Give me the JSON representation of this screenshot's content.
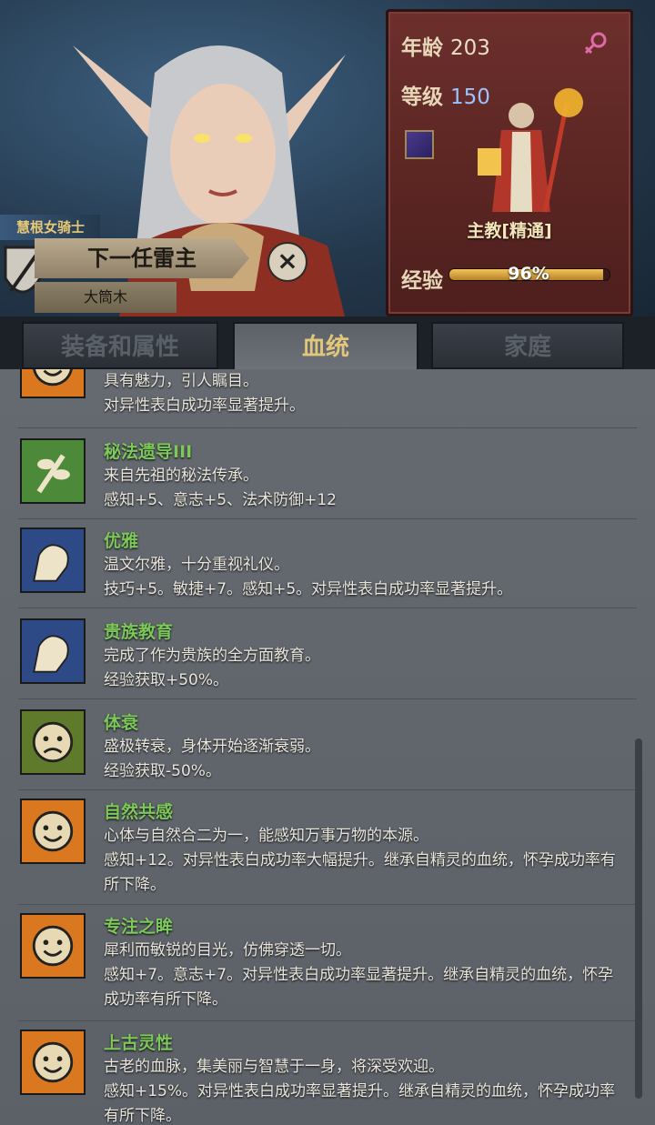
{
  "character": {
    "title": "慧根女骑士",
    "name": "下一任雷主",
    "family": "大筒木"
  },
  "stats": {
    "age_label": "年龄",
    "age_value": "203",
    "level_label": "等级",
    "level_value": "150",
    "class_label": "主教[精通]",
    "exp_label": "经验",
    "exp_value": "96%",
    "exp_fraction": 0.96
  },
  "tabs": [
    {
      "label": "装备和属性",
      "active": false
    },
    {
      "label": "血统",
      "active": true
    },
    {
      "label": "家庭",
      "active": false
    }
  ],
  "traits": [
    {
      "name": "",
      "icon": "happy-face-icon",
      "desc": "具有魅力，引人瞩目。\n对异性表白成功率显著提升。"
    },
    {
      "name": "秘法遗导III",
      "icon": "leaf-branch-icon",
      "desc": "来自先祖的秘法传承。\n感知+5、意志+5、法术防御+12"
    },
    {
      "name": "优雅",
      "icon": "flexed-arm-icon",
      "desc": "温文尔雅，十分重视礼仪。\n技巧+5。敏捷+7。感知+5。对异性表白成功率显著提升。"
    },
    {
      "name": "贵族教育",
      "icon": "flexed-arm-icon",
      "desc": "完成了作为贵族的全方面教育。\n经验获取+50%。"
    },
    {
      "name": "体衰",
      "icon": "sad-face-icon",
      "desc": "盛极转衰，身体开始逐渐衰弱。\n经验获取-50%。"
    },
    {
      "name": "自然共感",
      "icon": "happy-face-icon",
      "desc": "心体与自然合二为一，能感知万事万物的本源。\n感知+12。对异性表白成功率大幅提升。继承自精灵的血统，怀孕成功率有所下降。"
    },
    {
      "name": "专注之眸",
      "icon": "happy-face-icon",
      "desc": "犀利而敏锐的目光，仿佛穿透一切。\n感知+7。意志+7。对异性表白成功率显著提升。继承自精灵的血统，怀孕成功率有所下降。"
    },
    {
      "name": "上古灵性",
      "icon": "happy-face-icon",
      "desc": "古老的血脉，集美丽与智慧于一身，将深受欢迎。\n感知+15%。对异性表白成功率显著提升。继承自精灵的血统，怀孕成功率有所下降。"
    }
  ]
}
